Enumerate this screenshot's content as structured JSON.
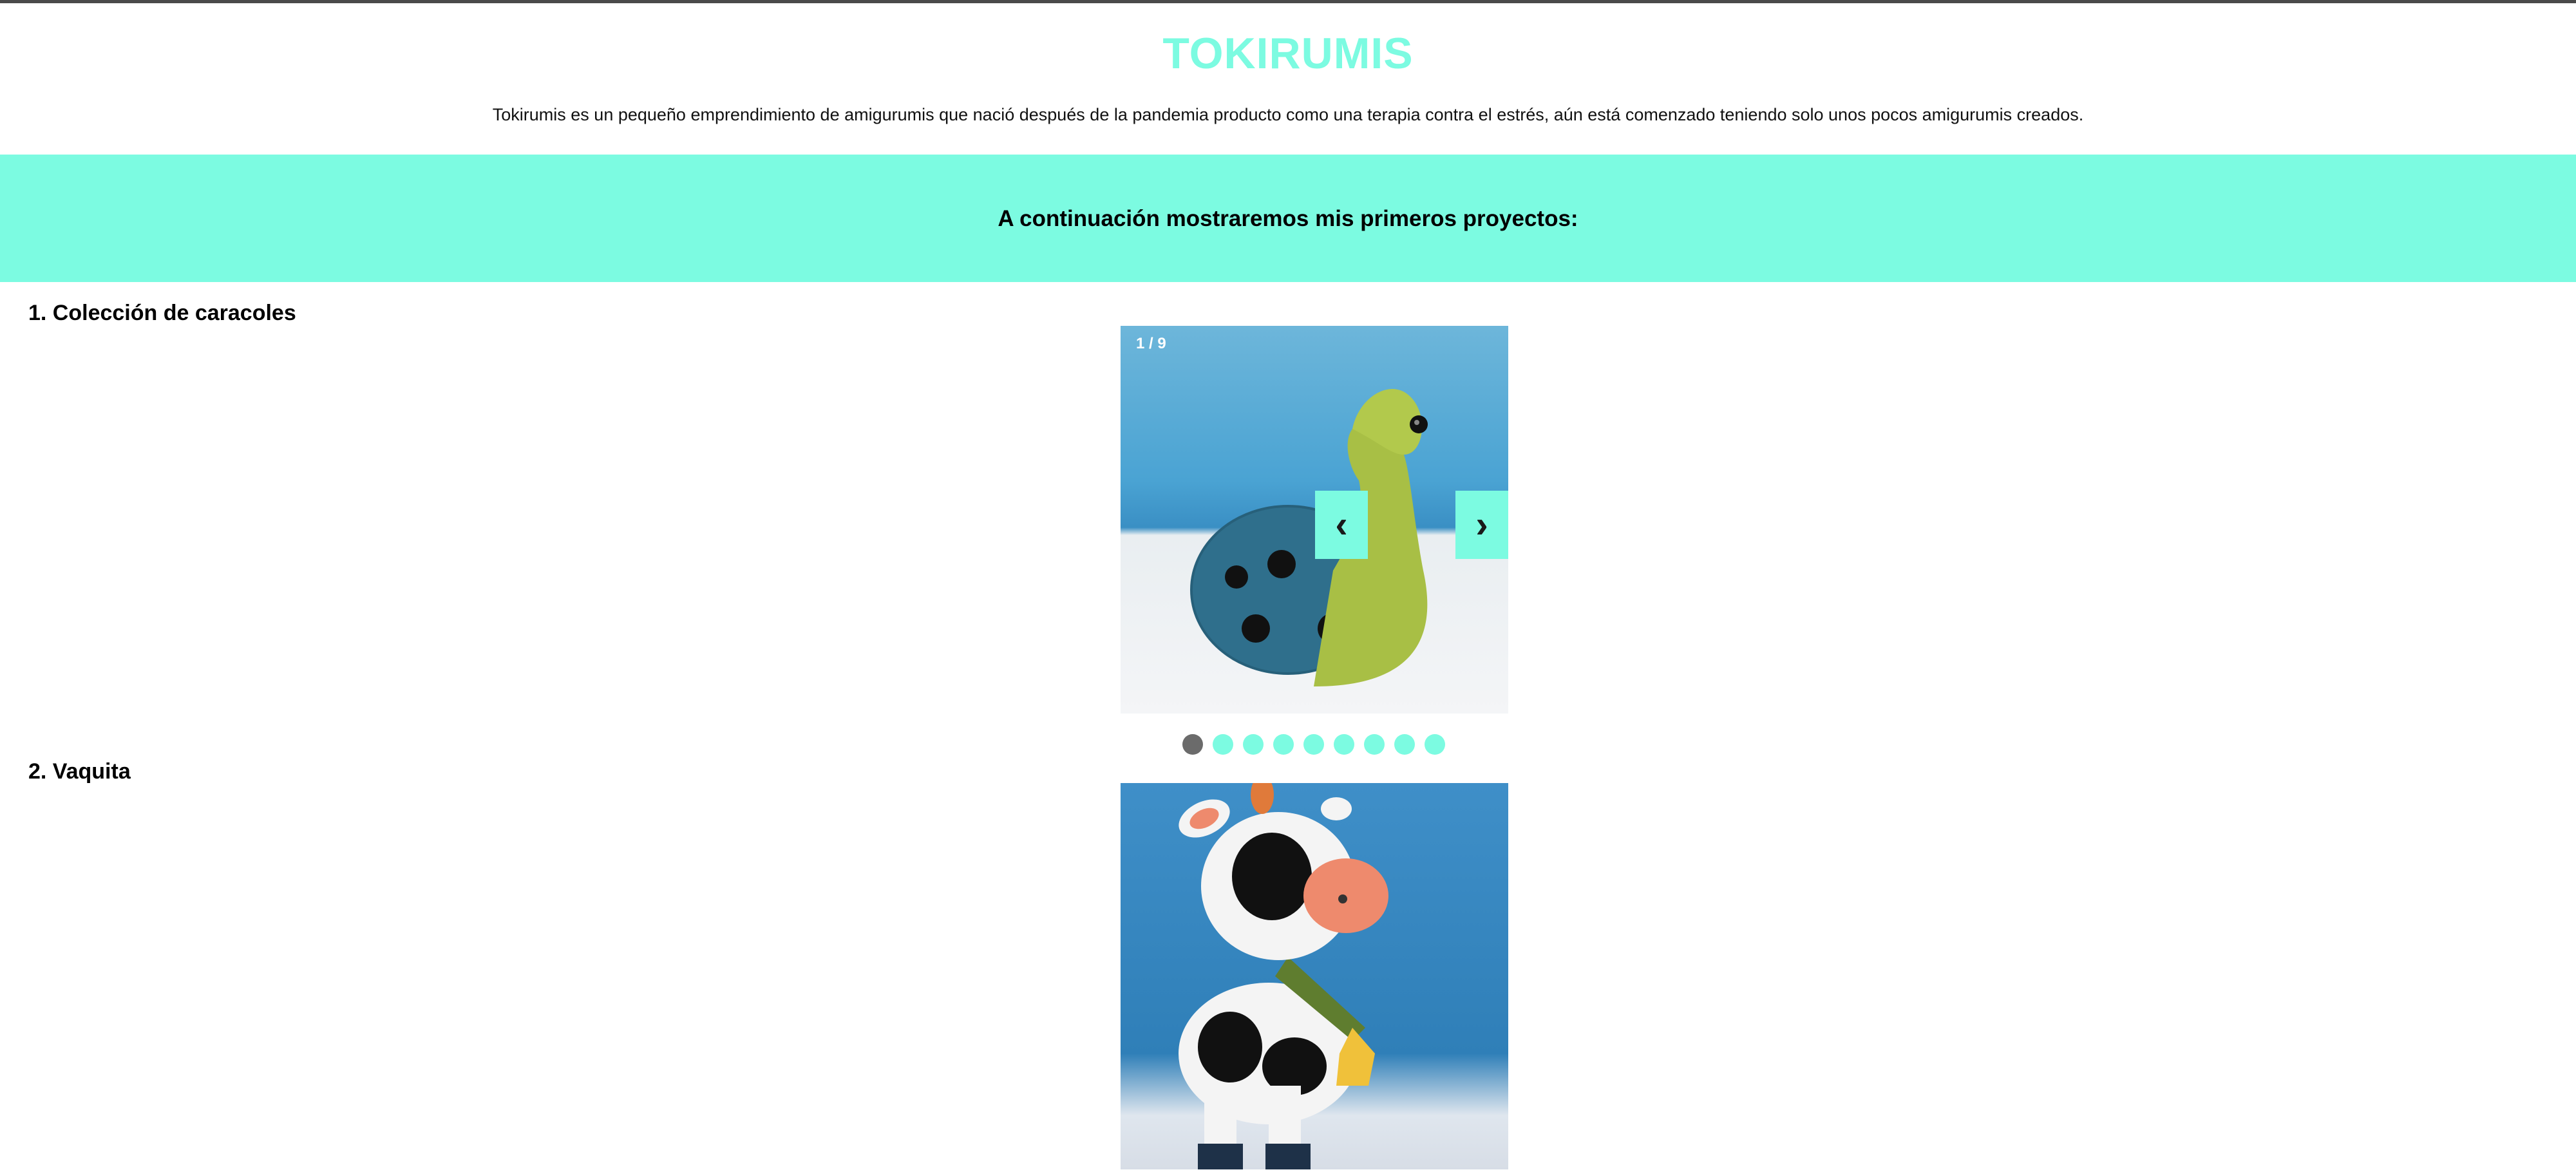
{
  "header": {
    "title": "TOKIRUMIS",
    "description": "Tokirumis es un pequeño emprendimiento de amigurumis que nació después de la pandemia producto como una terapia contra el estrés, aún está comenzado teniendo solo unos pocos amigurumis creados."
  },
  "banner": {
    "text": "A continuación mostraremos mis primeros proyectos:"
  },
  "sections": [
    {
      "heading": "1. Colección de caracoles",
      "slide_counter": "1 / 9",
      "prev_label": "‹",
      "next_label": "›",
      "slide_count": 9,
      "active_slide": 1
    },
    {
      "heading": "2. Vaquita"
    }
  ],
  "colors": {
    "accent": "#7cfbe1",
    "active_dot": "#6b6b6b"
  }
}
